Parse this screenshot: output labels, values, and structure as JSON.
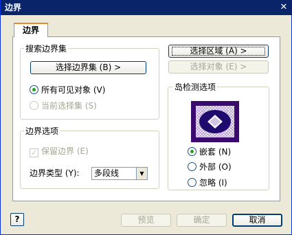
{
  "window": {
    "title": "边界",
    "close_glyph": "✕"
  },
  "tab": {
    "label": "边界"
  },
  "search_group": {
    "label": "搜索边界集",
    "select_set_button": "选择边界集 (B) >",
    "radio_all_visible": "所有可见对象 (V)",
    "radio_current_selection": "当前选择集 (S)"
  },
  "boundary_group": {
    "label": "边界选项",
    "keep_boundary": "保留边界 (E)",
    "type_label": "边界类型 (Y):",
    "type_value": "多段线"
  },
  "right": {
    "select_region_button": "选择区域 (A) >",
    "select_objects_button": "选择对象 (E) >"
  },
  "island_group": {
    "label": "岛检测选项",
    "nested": "嵌套 (N)",
    "outer": "外部 (O)",
    "ignore": "忽略 (I)"
  },
  "footer": {
    "help": "?",
    "preview": "预览",
    "ok": "确定",
    "cancel": "取消"
  },
  "colors": {
    "preview_frame": "#3a0a6e",
    "island_fill": "#1f0a6e",
    "accent_tab": "#e68b2c"
  }
}
